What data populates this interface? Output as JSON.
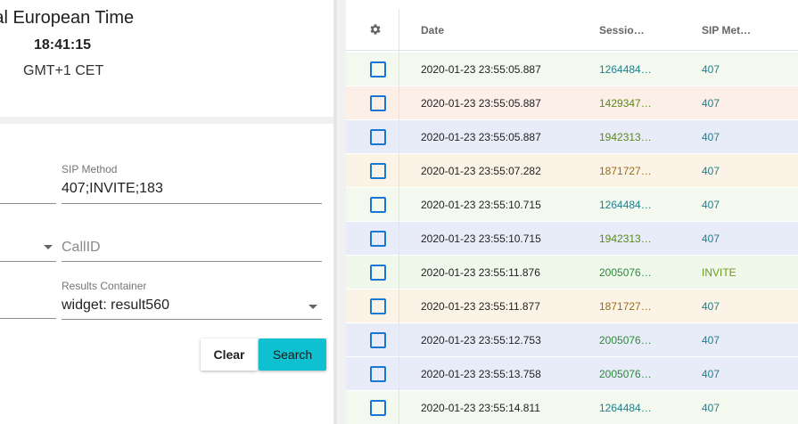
{
  "clock": {
    "title": "ntral European Time",
    "time": "18:41:15",
    "timezone": "GMT+1 CET"
  },
  "form": {
    "sip_method": {
      "label": "SIP Method",
      "value": "407;INVITE;183"
    },
    "callid": {
      "placeholder": "CallID"
    },
    "results_container": {
      "label": "Results Container",
      "value": "widget: result560"
    },
    "clear_label": "Clear",
    "search_label": "Search"
  },
  "table": {
    "settings_icon": "gear-icon",
    "columns": [
      "Date",
      "Sessio…",
      "SIP Met…"
    ],
    "rows": [
      {
        "date": "2020-01-23 23:55:05.887",
        "session": "1264484…",
        "method": "407",
        "bg": "#f3f9ef",
        "session_color": "#1e7e8c",
        "method_color": "#1e7e8c"
      },
      {
        "date": "2020-01-23 23:55:05.887",
        "session": "1429347…",
        "method": "407",
        "bg": "#fcefe8",
        "session_color": "#5a8a1a",
        "method_color": "#1e7e8c"
      },
      {
        "date": "2020-01-23 23:55:05.887",
        "session": "1942313…",
        "method": "407",
        "bg": "#e8ebf8",
        "session_color": "#5a8a1a",
        "method_color": "#1e7e8c"
      },
      {
        "date": "2020-01-23 23:55:07.282",
        "session": "1871727…",
        "method": "407",
        "bg": "#fbf4e6",
        "session_color": "#9a6a1a",
        "method_color": "#1e7e8c"
      },
      {
        "date": "2020-01-23 23:55:10.715",
        "session": "1264484…",
        "method": "407",
        "bg": "#f3f9ef",
        "session_color": "#1e7e8c",
        "method_color": "#1e7e8c"
      },
      {
        "date": "2020-01-23 23:55:10.715",
        "session": "1942313…",
        "method": "407",
        "bg": "#e8ebf8",
        "session_color": "#5a8a1a",
        "method_color": "#1e7e8c"
      },
      {
        "date": "2020-01-23 23:55:11.876",
        "session": "2005076…",
        "method": "INVITE",
        "bg": "#f0f8ec",
        "session_color": "#2e8a3a",
        "method_color": "#6a9a1a"
      },
      {
        "date": "2020-01-23 23:55:11.877",
        "session": "1871727…",
        "method": "407",
        "bg": "#fbf4e6",
        "session_color": "#9a6a1a",
        "method_color": "#1e7e8c"
      },
      {
        "date": "2020-01-23 23:55:12.753",
        "session": "2005076…",
        "method": "407",
        "bg": "#e8ebf8",
        "session_color": "#2e8a3a",
        "method_color": "#1e7e8c"
      },
      {
        "date": "2020-01-23 23:55:13.758",
        "session": "2005076…",
        "method": "407",
        "bg": "#e8ebf8",
        "session_color": "#2e8a3a",
        "method_color": "#1e7e8c"
      },
      {
        "date": "2020-01-23 23:55:14.811",
        "session": "1264484…",
        "method": "407",
        "bg": "#f3f9ef",
        "session_color": "#1e7e8c",
        "method_color": "#1e7e8c"
      }
    ]
  },
  "colors": {
    "checkbox": "#1976d2",
    "search_button": "#0fc0d0"
  }
}
